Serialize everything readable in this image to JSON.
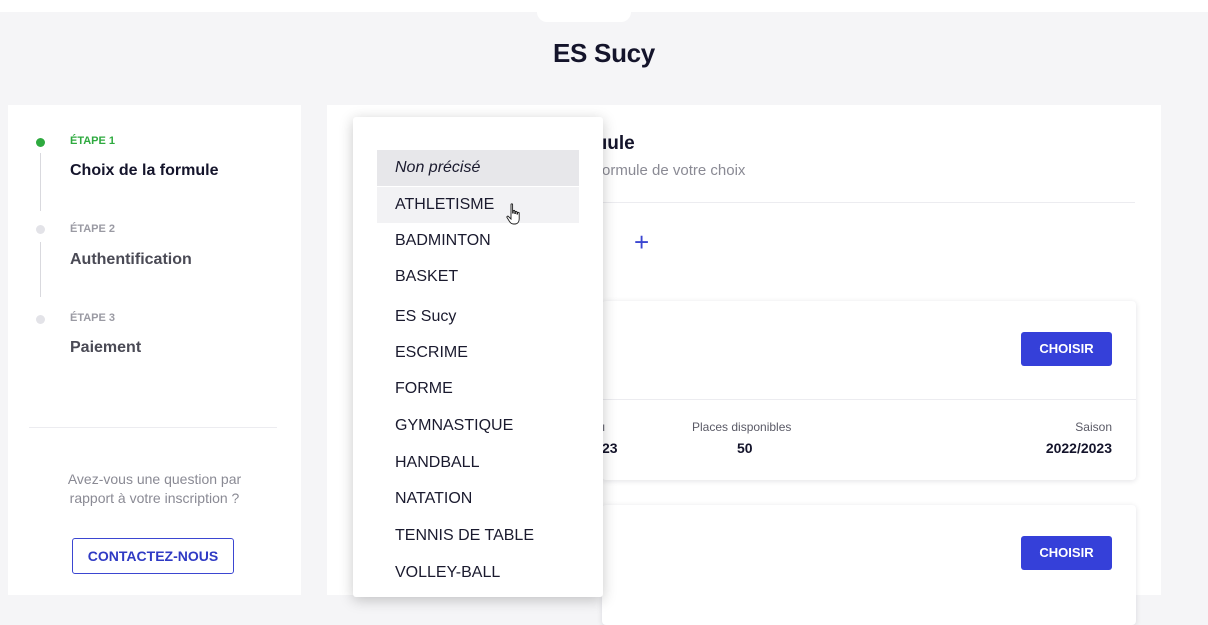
{
  "header": {
    "club_name": "ES Sucy"
  },
  "sidebar": {
    "steps": [
      {
        "tag": "ÉTAPE 1",
        "name": "Choix de la formule",
        "active": true
      },
      {
        "tag": "ÉTAPE 2",
        "name": "Authentification",
        "active": false
      },
      {
        "tag": "ÉTAPE 3",
        "name": "Paiement",
        "active": false
      }
    ],
    "help_text_line1": "Avez-vous une question par",
    "help_text_line2": "rapport à votre inscription ?",
    "contact_label": "CONTACTEZ-NOUS"
  },
  "main": {
    "title_partial": "ıule",
    "subtitle_partial": "ormule de votre choix",
    "add_icon": "plus-icon",
    "card1": {
      "choose_label": "CHOISIR",
      "partial_label": "ı",
      "partial_value": "23",
      "places_label": "Places disponibles",
      "places_value": "50",
      "season_label": "Saison",
      "season_value": "2022/2023"
    },
    "card2": {
      "choose_label": "CHOISIR"
    }
  },
  "dropdown": {
    "options": [
      "Non précisé",
      "ATHLETISME",
      "BADMINTON",
      "BASKET",
      "ES Sucy",
      "ESCRIME",
      "FORME",
      "GYMNASTIQUE",
      "HANDBALL",
      "NATATION",
      "TENNIS DE TABLE",
      "VOLLEY-BALL"
    ],
    "selected_index": 0,
    "hover_index": 1
  },
  "colors": {
    "accent": "#3540d9",
    "step_active": "#2eaa3f",
    "background": "#f5f5f7"
  }
}
